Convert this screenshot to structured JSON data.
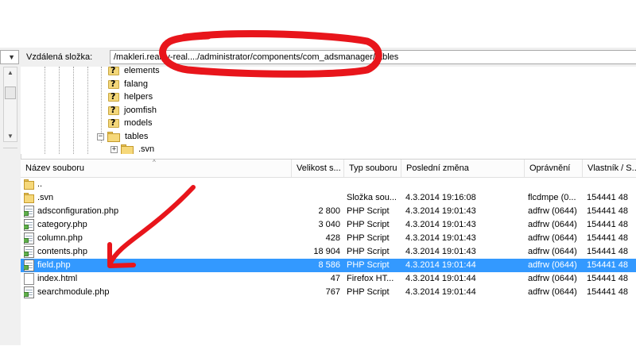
{
  "remote": {
    "label": "Vzdálená složka:",
    "path": "/makleri.reality-real..../administrator/components/com_adsmanager/tables"
  },
  "tree": {
    "items": [
      {
        "label": "elements",
        "icon": "question-folder-icon"
      },
      {
        "label": "falang",
        "icon": "question-folder-icon"
      },
      {
        "label": "helpers",
        "icon": "question-folder-icon"
      },
      {
        "label": "joomfish",
        "icon": "question-folder-icon"
      },
      {
        "label": "models",
        "icon": "question-folder-icon"
      },
      {
        "label": "tables",
        "icon": "open-folder-icon",
        "expanded": true
      },
      {
        "label": ".svn",
        "icon": "folder-icon",
        "expanded": false
      }
    ]
  },
  "list": {
    "columns": [
      "Název souboru",
      "Velikost s...",
      "Typ souboru",
      "Poslední změna",
      "Oprávnění",
      "Vlastník / S..."
    ],
    "rows": [
      {
        "name": "..",
        "size": "",
        "type": "",
        "modified": "",
        "perm": "",
        "owner": "",
        "icon": "folder-icon"
      },
      {
        "name": ".svn",
        "size": "",
        "type": "Složka sou...",
        "modified": "4.3.2014 19:16:08",
        "perm": "flcdmpe (0...",
        "owner": "154441 48",
        "icon": "folder-icon"
      },
      {
        "name": "adsconfiguration.php",
        "size": "2 800",
        "type": "PHP Script",
        "modified": "4.3.2014 19:01:43",
        "perm": "adfrw (0644)",
        "owner": "154441 48",
        "icon": "php-file-icon"
      },
      {
        "name": "category.php",
        "size": "3 040",
        "type": "PHP Script",
        "modified": "4.3.2014 19:01:43",
        "perm": "adfrw (0644)",
        "owner": "154441 48",
        "icon": "php-file-icon"
      },
      {
        "name": "column.php",
        "size": "428",
        "type": "PHP Script",
        "modified": "4.3.2014 19:01:43",
        "perm": "adfrw (0644)",
        "owner": "154441 48",
        "icon": "php-file-icon"
      },
      {
        "name": "contents.php",
        "size": "18 904",
        "type": "PHP Script",
        "modified": "4.3.2014 19:01:43",
        "perm": "adfrw (0644)",
        "owner": "154441 48",
        "icon": "php-file-icon"
      },
      {
        "name": "field.php",
        "size": "8 586",
        "type": "PHP Script",
        "modified": "4.3.2014 19:01:44",
        "perm": "adfrw (0644)",
        "owner": "154441 48",
        "icon": "php-file-icon",
        "selected": true
      },
      {
        "name": "index.html",
        "size": "47",
        "type": "Firefox HT...",
        "modified": "4.3.2014 19:01:44",
        "perm": "adfrw (0644)",
        "owner": "154441 48",
        "icon": "html-file-icon"
      },
      {
        "name": "searchmodule.php",
        "size": "767",
        "type": "PHP Script",
        "modified": "4.3.2014 19:01:44",
        "perm": "adfrw (0644)",
        "owner": "154441 48",
        "icon": "php-file-icon"
      }
    ]
  },
  "colors": {
    "selection": "#3399ff",
    "annotation": "#e8151b"
  }
}
